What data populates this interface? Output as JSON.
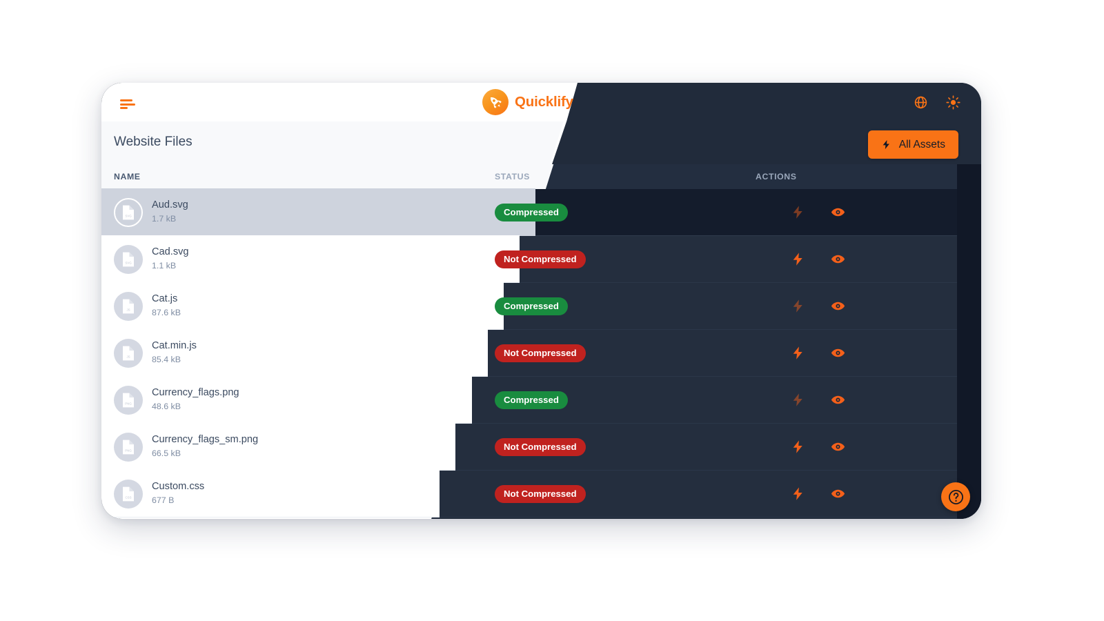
{
  "app": {
    "brand_name": "Quicklify",
    "brand_logo_icon": "rocket-icon",
    "menu_icon": "hamburger-menu-icon",
    "topbar_icons": [
      {
        "name": "globe-icon",
        "label": "Language"
      },
      {
        "name": "brightness-icon",
        "label": "Theme"
      }
    ],
    "accent_color": "#f97316",
    "dark_color": "#212b3b",
    "darker_color": "#111827"
  },
  "page": {
    "title": "Website Files",
    "all_assets_button": {
      "label": "All Assets",
      "icon": "bolt-icon"
    }
  },
  "table": {
    "columns": [
      "NAME",
      "STATUS",
      "ACTIONS"
    ],
    "action_icons": [
      "bolt-icon",
      "eye-icon"
    ],
    "status_colors": {
      "compressed": "#198c3f",
      "not_compressed": "#c0221f"
    },
    "rows": [
      {
        "name": "Aud.svg",
        "size": "1.7 kB",
        "type": "svg",
        "status": "Compressed",
        "status_class": "compressed",
        "selected": true,
        "bolt_enabled": false
      },
      {
        "name": "Cad.svg",
        "size": "1.1 kB",
        "type": "svg",
        "status": "Not Compressed",
        "status_class": "not-compressed",
        "selected": false,
        "bolt_enabled": true
      },
      {
        "name": "Cat.js",
        "size": "87.6 kB",
        "type": "js",
        "status": "Compressed",
        "status_class": "compressed",
        "selected": false,
        "bolt_enabled": false
      },
      {
        "name": "Cat.min.js",
        "size": "85.4 kB",
        "type": "js",
        "status": "Not Compressed",
        "status_class": "not-compressed",
        "selected": false,
        "bolt_enabled": true
      },
      {
        "name": "Currency_flags.png",
        "size": "48.6 kB",
        "type": "png",
        "status": "Compressed",
        "status_class": "compressed",
        "selected": false,
        "bolt_enabled": false
      },
      {
        "name": "Currency_flags_sm.png",
        "size": "66.5 kB",
        "type": "png",
        "status": "Not Compressed",
        "status_class": "not-compressed",
        "selected": false,
        "bolt_enabled": true
      },
      {
        "name": "Custom.css",
        "size": "677 B",
        "type": "css",
        "status": "Not Compressed",
        "status_class": "not-compressed",
        "selected": false,
        "bolt_enabled": true
      }
    ]
  },
  "help": {
    "icon": "question-mark-icon",
    "label": "Help"
  }
}
